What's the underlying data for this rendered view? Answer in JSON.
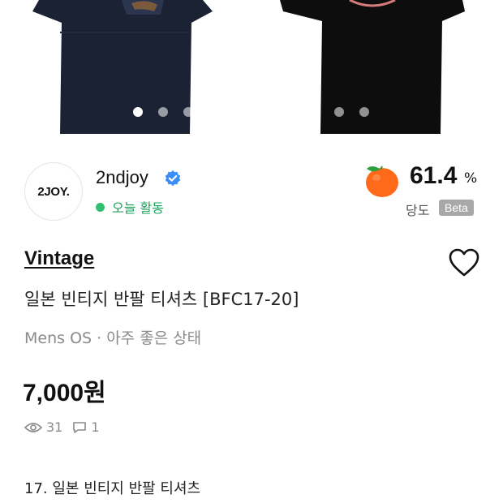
{
  "gallery": {
    "total_slides": 10,
    "active_index": 0
  },
  "seller": {
    "avatar_text": "2JOY.",
    "name": "2ndjoy",
    "verified_icon": "verified-badge-icon",
    "activity": "오늘 활동",
    "temperature_value": "61.4",
    "temperature_unit": "%",
    "temperature_label": "당도",
    "beta_label": "Beta",
    "temperature_icon": "tangerine-icon"
  },
  "product": {
    "brand": "Vintage",
    "title": "일본 빈티지 반팔 티셔츠 [BFC17-20]",
    "meta": "Mens OS · 아주 좋은 상태",
    "price": "7,000원",
    "views": "31",
    "chats": "1",
    "description_first_line": "17. 일본 빈티지 반팔 티셔츠"
  },
  "colors": {
    "accent_green": "#2fbf71",
    "verified_blue": "#3a8ef6",
    "tangerine": "#ff6a1a",
    "beta_bg": "#a8a8a8"
  }
}
